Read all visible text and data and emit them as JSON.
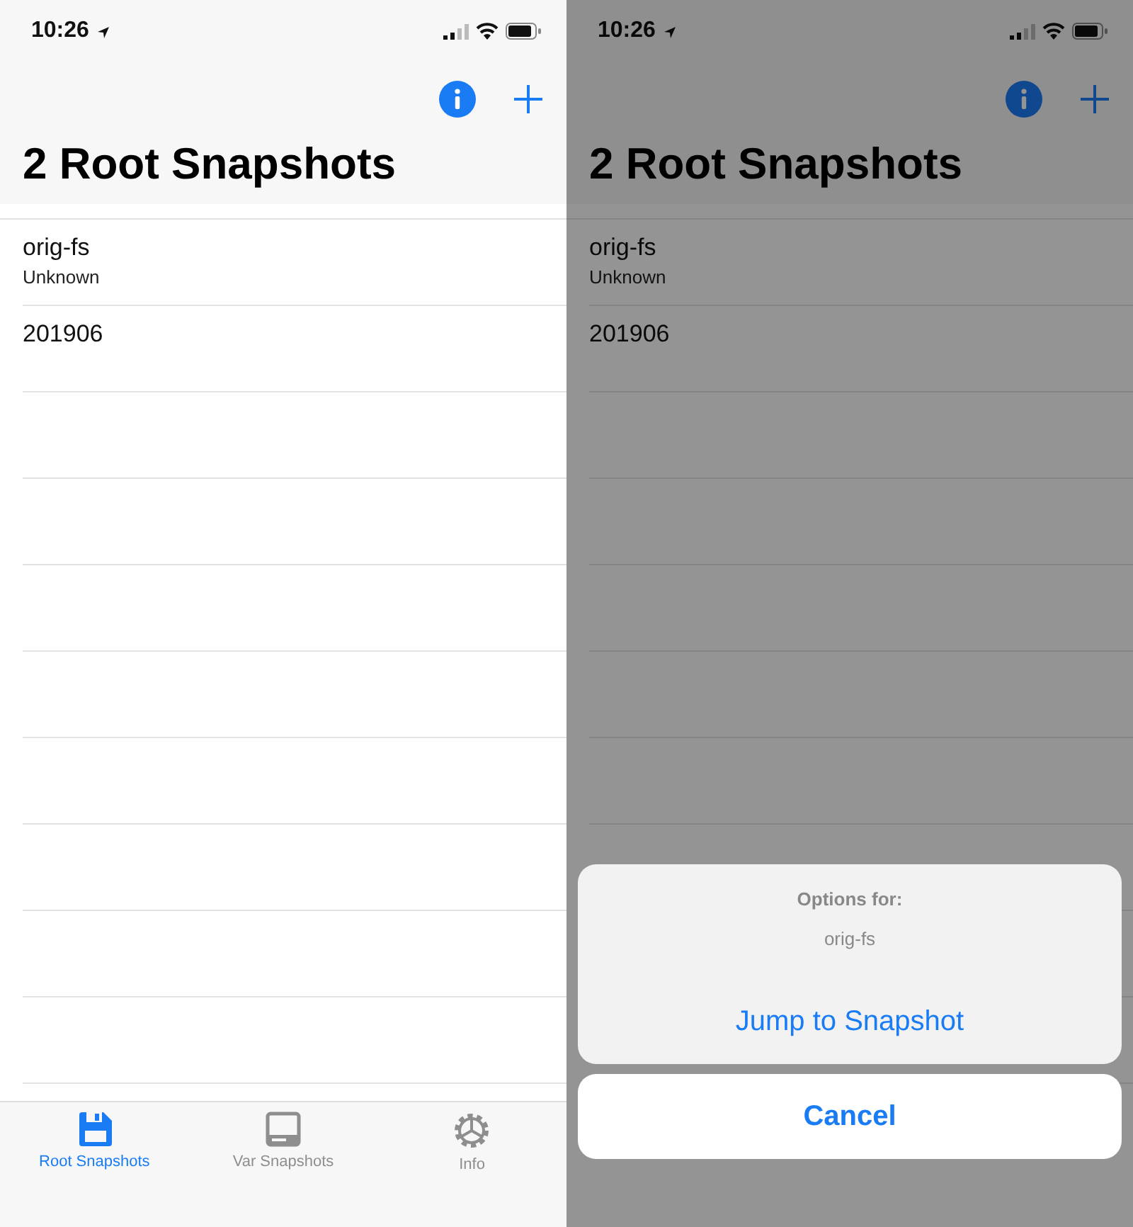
{
  "screens": [
    {
      "dimmed": false,
      "status_bar": {
        "time": "10:26"
      },
      "title": "2 Root Snapshots",
      "rows": [
        {
          "title": "orig-fs",
          "subtitle": "Unknown"
        },
        {
          "title": "201906"
        }
      ],
      "tab_bar": [
        {
          "label": "Root Snapshots",
          "kind": "save",
          "selected": true
        },
        {
          "label": "Var Snapshots",
          "kind": "drive",
          "selected": false
        },
        {
          "label": "Info",
          "kind": "gear",
          "selected": false
        }
      ]
    },
    {
      "dimmed": true,
      "status_bar": {
        "time": "10:26"
      },
      "title": "2 Root Snapshots",
      "rows": [
        {
          "title": "orig-fs",
          "subtitle": "Unknown"
        },
        {
          "title": "201906"
        }
      ],
      "action_sheet": {
        "title": "Options for:",
        "message": "orig-fs",
        "actions": [
          "Jump to Snapshot"
        ],
        "cancel": "Cancel"
      }
    }
  ]
}
